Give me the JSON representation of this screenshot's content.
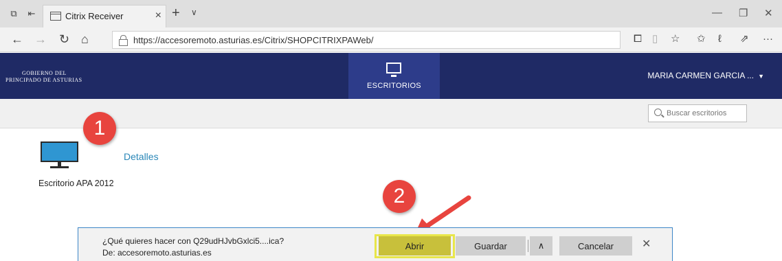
{
  "browser": {
    "tab_title": "Citrix Receiver",
    "url": "https://accesoremoto.asturias.es/Citrix/SHOPCITRIXPAWeb/"
  },
  "header": {
    "org_line1": "GOBIERNO DEL",
    "org_line2": "PRINCIPADO DE ASTURIAS",
    "desktops_tab_label": "ESCRITORIOS",
    "user_name": "MARIA CARMEN GARCIA ...",
    "bg_color": "#1f2a65",
    "active_tab_color": "#2d3c8a"
  },
  "search": {
    "placeholder": "Buscar escritorios"
  },
  "main": {
    "desktop_name": "Escritorio APA 2012",
    "details_link": "Detalles",
    "link_color": "#2a87b8"
  },
  "annotations": {
    "callout_1": "1",
    "callout_2": "2",
    "callout_color": "#e8443e"
  },
  "download_bar": {
    "question": "¿Qué quieres hacer con Q29udHJvbGxlci5....ica?",
    "from": "De: accesoremoto.asturias.es",
    "open_label": "Abrir",
    "save_label": "Guardar",
    "cancel_label": "Cancelar",
    "highlight_color": "#e8e64a"
  }
}
